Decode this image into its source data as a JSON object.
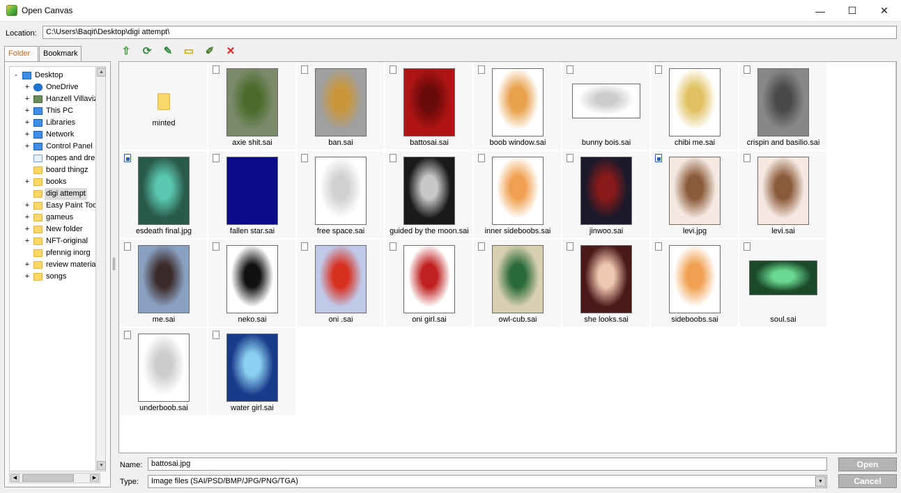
{
  "window": {
    "title": "Open Canvas",
    "minimize_label": "—",
    "maximize_label": "☐",
    "close_label": "✕"
  },
  "location": {
    "label": "Location:",
    "value": "C:\\Users\\Baqit\\Desktop\\digi attempt\\"
  },
  "tabs": [
    {
      "label": "Folder",
      "active": true
    },
    {
      "label": "Bookmark",
      "active": false
    }
  ],
  "tree": [
    {
      "label": "Desktop",
      "expander": "-",
      "icon": "desktop-icon",
      "indent": 0
    },
    {
      "label": "OneDrive",
      "expander": "+",
      "icon": "cloud-icon",
      "indent": 1
    },
    {
      "label": "Hanzell Villaviza",
      "expander": "+",
      "icon": "user-icon",
      "indent": 1
    },
    {
      "label": "This PC",
      "expander": "+",
      "icon": "computer-icon",
      "indent": 1
    },
    {
      "label": "Libraries",
      "expander": "+",
      "icon": "library-icon",
      "indent": 1
    },
    {
      "label": "Network",
      "expander": "+",
      "icon": "network-icon",
      "indent": 1
    },
    {
      "label": "Control Panel",
      "expander": "+",
      "icon": "control-panel-icon",
      "indent": 1
    },
    {
      "label": "hopes and dreams",
      "expander": "",
      "icon": "special-folder-icon",
      "indent": 1
    },
    {
      "label": "board thingz",
      "expander": "",
      "icon": "folder-icon",
      "indent": 1
    },
    {
      "label": "books",
      "expander": "+",
      "icon": "folder-icon",
      "indent": 1
    },
    {
      "label": "digi attempt",
      "expander": "",
      "icon": "folder-icon",
      "indent": 1,
      "selected": true
    },
    {
      "label": "Easy Paint Tool",
      "expander": "+",
      "icon": "folder-icon",
      "indent": 1
    },
    {
      "label": "gameus",
      "expander": "+",
      "icon": "folder-icon",
      "indent": 1
    },
    {
      "label": "New folder",
      "expander": "+",
      "icon": "folder-icon",
      "indent": 1
    },
    {
      "label": "NFT-original",
      "expander": "+",
      "icon": "folder-icon",
      "indent": 1
    },
    {
      "label": "pfennig inorg",
      "expander": "",
      "icon": "folder-icon",
      "indent": 1
    },
    {
      "label": "review materials",
      "expander": "+",
      "icon": "folder-icon",
      "indent": 1
    },
    {
      "label": "songs",
      "expander": "+",
      "icon": "folder-icon",
      "indent": 1
    }
  ],
  "toolbar": [
    {
      "name": "up-folder-icon",
      "glyph": "⇧",
      "color": "#3a9a3a"
    },
    {
      "name": "refresh-icon",
      "glyph": "⟳",
      "color": "#2e8b3a"
    },
    {
      "name": "bookmark-icon",
      "glyph": "✎",
      "color": "#2e8b3a"
    },
    {
      "name": "new-folder-icon",
      "glyph": "▭",
      "color": "#d4a017"
    },
    {
      "name": "rename-icon",
      "glyph": "✐",
      "color": "#4a7a2a"
    },
    {
      "name": "delete-icon",
      "glyph": "✕",
      "color": "#d81e1e"
    }
  ],
  "files": [
    {
      "name": "minted",
      "type": "folder"
    },
    {
      "name": "axie shit.sai",
      "type": "sai",
      "thumb": "#7a8a6a",
      "accent": "#4a6b2a",
      "orient": "portrait"
    },
    {
      "name": "ban.sai",
      "type": "sai",
      "thumb": "#a0a0a0",
      "accent": "#c9963b",
      "orient": "portrait"
    },
    {
      "name": "battosai.sai",
      "type": "sai",
      "thumb": "#b01414",
      "accent": "#6a0a0a",
      "orient": "portrait"
    },
    {
      "name": "boob window.sai",
      "type": "sai",
      "thumb": "#ffffff",
      "accent": "#e8a04a",
      "orient": "portrait"
    },
    {
      "name": "bunny bois.sai",
      "type": "sai",
      "thumb": "#ffffff",
      "accent": "#cccccc",
      "orient": "landscape"
    },
    {
      "name": "chibi me.sai",
      "type": "sai",
      "thumb": "#ffffff",
      "accent": "#e0c060",
      "orient": "portrait"
    },
    {
      "name": "crispin and basilio.sai",
      "type": "sai",
      "thumb": "#888888",
      "accent": "#4a4a4a",
      "orient": "portrait"
    },
    {
      "name": "esdeath final.jpg",
      "type": "jpg",
      "thumb": "#2a5a4a",
      "accent": "#5ac8b0",
      "orient": "portrait"
    },
    {
      "name": "fallen star.sai",
      "type": "sai",
      "thumb": "#0a0a8a",
      "accent": "#0a0a8a",
      "orient": "portrait"
    },
    {
      "name": "free space.sai",
      "type": "sai",
      "thumb": "#ffffff",
      "accent": "#d0d0d0",
      "orient": "portrait"
    },
    {
      "name": "guided by the moon.sai",
      "type": "sai",
      "thumb": "#1a1a1a",
      "accent": "#c8c8c8",
      "orient": "portrait"
    },
    {
      "name": "inner sideboobs.sai",
      "type": "sai",
      "thumb": "#ffffff",
      "accent": "#f0a050",
      "orient": "portrait"
    },
    {
      "name": "jinwoo.sai",
      "type": "sai",
      "thumb": "#1a1a2a",
      "accent": "#8a1a1a",
      "orient": "portrait"
    },
    {
      "name": "levi.jpg",
      "type": "jpg",
      "thumb": "#f4e8e0",
      "accent": "#8a5a3a",
      "orient": "portrait"
    },
    {
      "name": "levi.sai",
      "type": "sai",
      "thumb": "#f4e8e0",
      "accent": "#8a5a3a",
      "orient": "portrait"
    },
    {
      "name": "me.sai",
      "type": "sai",
      "thumb": "#8aa0c0",
      "accent": "#3a2a2a",
      "orient": "portrait"
    },
    {
      "name": "neko.sai",
      "type": "sai",
      "thumb": "#ffffff",
      "accent": "#111111",
      "orient": "portrait"
    },
    {
      "name": "oni .sai",
      "type": "sai",
      "thumb": "#c0c8e8",
      "accent": "#d83020",
      "orient": "portrait"
    },
    {
      "name": "oni girl.sai",
      "type": "sai",
      "thumb": "#ffffff",
      "accent": "#c02020",
      "orient": "portrait"
    },
    {
      "name": "owl-cub.sai",
      "type": "sai",
      "thumb": "#d8d0b0",
      "accent": "#2a6a3a",
      "orient": "portrait"
    },
    {
      "name": "she looks.sai",
      "type": "sai",
      "thumb": "#4a1a1a",
      "accent": "#f0c8b0",
      "orient": "portrait"
    },
    {
      "name": "sideboobs.sai",
      "type": "sai",
      "thumb": "#ffffff",
      "accent": "#f0a050",
      "orient": "portrait"
    },
    {
      "name": "soul.sai",
      "type": "sai",
      "thumb": "#1a4a2a",
      "accent": "#6ad890",
      "orient": "landscape"
    },
    {
      "name": "underboob.sai",
      "type": "sai",
      "thumb": "#ffffff",
      "accent": "#cccccc",
      "orient": "portrait"
    },
    {
      "name": "water girl.sai",
      "type": "sai",
      "thumb": "#1a3a8a",
      "accent": "#8ad0f0",
      "orient": "portrait"
    }
  ],
  "name_field": {
    "label": "Name:",
    "value": "battosai.jpg"
  },
  "type_field": {
    "label": "Type:",
    "value": "Image files (SAI/PSD/BMP/JPG/PNG/TGA)"
  },
  "buttons": {
    "open": "Open",
    "cancel": "Cancel"
  }
}
